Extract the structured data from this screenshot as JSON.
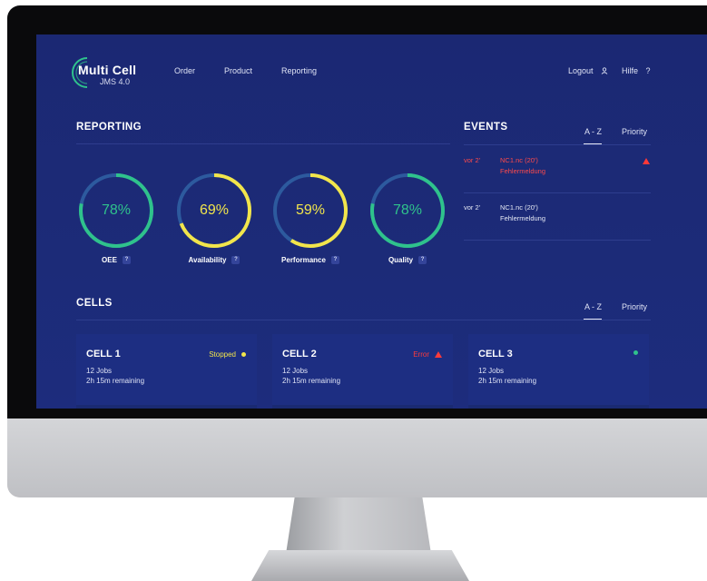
{
  "app": {
    "logo_title": "Multi Cell",
    "logo_subtitle": "JMS 4.0"
  },
  "nav": {
    "items": [
      {
        "label": "Order"
      },
      {
        "label": "Product"
      },
      {
        "label": "Reporting"
      }
    ],
    "logout": "Logout",
    "help": "Hilfe",
    "help_symbol": "?"
  },
  "reporting": {
    "title": "REPORTING",
    "kpis": [
      {
        "label": "OEE",
        "value_text": "78%",
        "value": 0.78,
        "ring_color": "#2fc28c",
        "text_color": "#2fc28c"
      },
      {
        "label": "Availability",
        "value_text": "69%",
        "value": 0.69,
        "ring_color": "#f2e54b",
        "text_color": "#f2e54b"
      },
      {
        "label": "Performance",
        "value_text": "59%",
        "value": 0.59,
        "ring_color": "#f2e54b",
        "text_color": "#f2e54b"
      },
      {
        "label": "Quality",
        "value_text": "78%",
        "value": 0.78,
        "ring_color": "#2fc28c",
        "text_color": "#2fc28c"
      }
    ],
    "help_badge": "?"
  },
  "events": {
    "title": "EVENTS",
    "sort_options": [
      "A - Z",
      "Priority"
    ],
    "active_sort": "A - Z",
    "rows": [
      {
        "time": "vor 2'",
        "title": "NC1.nc (20')",
        "message": "Fehlermeldung",
        "severity": "error"
      },
      {
        "time": "vor 2'",
        "title": "NC1.nc (20')",
        "message": "Fehlermeldung",
        "severity": "normal"
      }
    ]
  },
  "cells": {
    "title": "CELLS",
    "sort_options": [
      "A - Z",
      "Priority"
    ],
    "active_sort": "A - Z",
    "items": [
      {
        "name": "CELL 1",
        "jobs": "12 Jobs",
        "remaining": "2h 15m remaining",
        "status": "Stopped",
        "status_color": "#f2e54b"
      },
      {
        "name": "CELL 2",
        "jobs": "12 Jobs",
        "remaining": "2h 15m remaining",
        "status": "Error",
        "status_color": "#ff3b3b"
      },
      {
        "name": "CELL 3",
        "jobs": "12 Jobs",
        "remaining": "2h 15m remaining",
        "status": "",
        "status_color": "#2fc28c"
      }
    ]
  },
  "colors": {
    "screen_bg": "#1b2873",
    "accent_green": "#2fc28c",
    "accent_yellow": "#f2e54b",
    "error_red": "#ff3b3b",
    "track": "#2d5a9e"
  }
}
